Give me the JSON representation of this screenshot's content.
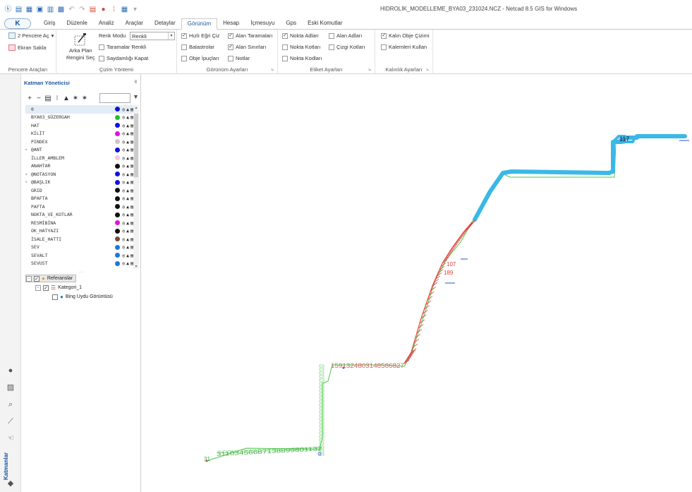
{
  "window": {
    "title": "HIDROLİK_MODELLEME_BYA03_231024.NCZ - Netcad 8.5 GIS for Windows"
  },
  "quick_access": {
    "dropdown_glyph": "▾"
  },
  "app_button": {
    "label": "K"
  },
  "tabs": [
    {
      "label": "Giriş"
    },
    {
      "label": "Düzenle"
    },
    {
      "label": "Analiz"
    },
    {
      "label": "Araçlar"
    },
    {
      "label": "Detaylar"
    },
    {
      "label": "Görünüm",
      "active": true
    },
    {
      "label": "Hesap"
    },
    {
      "label": "İçmesuyu"
    },
    {
      "label": "Gps"
    },
    {
      "label": "Eski Komutlar"
    }
  ],
  "ribbon": {
    "pencere": {
      "label": "Pencere Araçları",
      "items": [
        {
          "label": "2 Pencere Aç",
          "dropdown": "▾"
        },
        {
          "label": "Ekran Sakla"
        }
      ]
    },
    "cizim": {
      "label": "Çizim Yöntemi",
      "arkaplan": {
        "line1": "Arka Plan",
        "line2": "Rengini Seç"
      },
      "renk_modu_label": "Renk Modu",
      "renk_modu_value": "Renkli",
      "taramalar_renkli": {
        "label": "Taramalar Renkli",
        "checked": false
      },
      "saydamligi_kapat": {
        "label": "Saydamlığı Kapat",
        "checked": false
      }
    },
    "gorunum": {
      "label": "Görünüm Ayarları",
      "items": [
        {
          "label": "Hızlı Eğri Çiz",
          "checked": true
        },
        {
          "label": "Alan Taramaları",
          "checked": true
        },
        {
          "label": "Balastrolar",
          "checked": false
        },
        {
          "label": "Alan Sınırları",
          "checked": true
        },
        {
          "label": "Obje İpuçları",
          "checked": false
        },
        {
          "label": "Notlar",
          "checked": false
        }
      ]
    },
    "etiket": {
      "label": "Etiket Ayarları",
      "items": [
        {
          "label": "Nokta Adları",
          "checked": true
        },
        {
          "label": "Alan Adları",
          "checked": false
        },
        {
          "label": "Nokta Kotları",
          "checked": false
        },
        {
          "label": "Çizgi Kotları",
          "checked": false
        },
        {
          "label": "Nokta Kodları",
          "checked": false
        }
      ]
    },
    "kalinlik": {
      "label": "Kalınlık Ayarları",
      "items": [
        {
          "label": "Kalın Obje Çizimi",
          "checked": true
        },
        {
          "label": "Kalemleri Kullan",
          "checked": false
        }
      ]
    },
    "launcher_glyph": "⊾"
  },
  "layer_panel": {
    "title": "Katman Yöneticisi",
    "pin": "ᴮ",
    "layers": [
      {
        "name": "0",
        "color": "#1010e0",
        "selected": true
      },
      {
        "name": "BYA03_GÜZERGAH",
        "color": "#22c422"
      },
      {
        "name": "HAT",
        "color": "#1010e0"
      },
      {
        "name": "KİLİT",
        "color": "#e010e0"
      },
      {
        "name": "PINDEX",
        "color": "#c8c8c8"
      },
      {
        "name": "@ANT",
        "color": "#1010e0",
        "group": true
      },
      {
        "name": "İLLER_AMBLEM",
        "color": "#f0c8d8"
      },
      {
        "name": "ANAHTAR",
        "color": "#111111"
      },
      {
        "name": "@NOTASYON",
        "color": "#1010e0",
        "group": true
      },
      {
        "name": "@BAŞLIK",
        "color": "#1010e0",
        "group": true
      },
      {
        "name": "GRID",
        "color": "#111111"
      },
      {
        "name": "BPAFTA",
        "color": "#111111"
      },
      {
        "name": "PAFTA",
        "color": "#111111"
      },
      {
        "name": "NOKTA_VE_KOTLAR",
        "color": "#111111"
      },
      {
        "name": "RESMİBİNA",
        "color": "#e010e0"
      },
      {
        "name": "OK_HATYAZI",
        "color": "#111111"
      },
      {
        "name": "İSALE_HATTI",
        "color": "#7a4a38"
      },
      {
        "name": "SEV",
        "color": "#1a78e0"
      },
      {
        "name": "SEVALT",
        "color": "#1a78e0"
      },
      {
        "name": "SEVUST",
        "color": "#1a78e0"
      }
    ]
  },
  "references": {
    "root": "Referanslar",
    "category": "Kategori_1",
    "item": "Bing Uydu Görüntüsü"
  },
  "sidebar": {
    "label": "Katmanlar"
  },
  "map": {
    "labels": {
      "top_right": "117",
      "mid_1": "189",
      "mid_2": "107",
      "street": "1591324803148586827",
      "bottom": "31103456687138899801132",
      "start": "31"
    },
    "colors": {
      "cyan": "#3ab8e8",
      "red": "#e04040",
      "green": "#44cc44",
      "blue": "#2a52d8"
    }
  }
}
